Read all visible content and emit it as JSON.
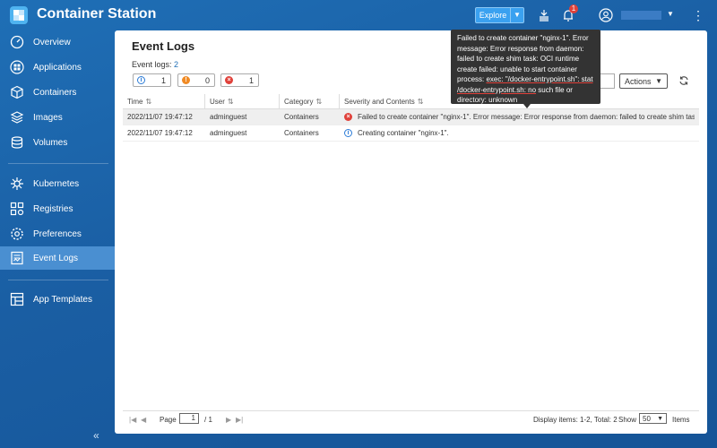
{
  "app": {
    "title": "Container Station"
  },
  "header": {
    "explore_label": "Explore",
    "notification_count": "1",
    "icons": [
      "explore-dropdown-icon",
      "stack-icon",
      "bell-icon",
      "user-avatar-icon",
      "more-vert-icon"
    ]
  },
  "sidebar": {
    "items": [
      {
        "label": "Overview",
        "icon": "gauge-icon"
      },
      {
        "label": "Applications",
        "icon": "grid-icon"
      },
      {
        "label": "Containers",
        "icon": "cube-icon"
      },
      {
        "label": "Images",
        "icon": "layers-icon"
      },
      {
        "label": "Volumes",
        "icon": "database-icon"
      },
      {
        "label": "Kubernetes",
        "icon": "helm-icon"
      },
      {
        "label": "Registries",
        "icon": "registry-icon"
      },
      {
        "label": "Preferences",
        "icon": "gear-icon"
      },
      {
        "label": "Event Logs",
        "icon": "log-icon"
      },
      {
        "label": "App Templates",
        "icon": "template-icon"
      }
    ],
    "active": "Event Logs"
  },
  "main": {
    "title": "Event Logs",
    "count_label": "Event logs:",
    "count_value": "2",
    "filters": {
      "info": "1",
      "warning": "0",
      "error": "1"
    },
    "actions_label": "Actions"
  },
  "table": {
    "headers": {
      "time": "Time",
      "user": "User",
      "category": "Category",
      "severity": "Severity and Contents"
    },
    "rows": [
      {
        "time": "2022/11/07 19:47:12",
        "user": "adminguest",
        "category": "Containers",
        "severity": "error",
        "content": "Failed to create container \"nginx-1\". Error message: Error response from daemon: failed to create shim task: OCI runtime create failed: unable to start container process: exec: \"/docker-entrypoint.sh\": stat /docker-entrypoint.sh: no such file or directory: unknown"
      },
      {
        "time": "2022/11/07 19:47:12",
        "user": "adminguest",
        "category": "Containers",
        "severity": "info",
        "content": "Creating container \"nginx-1\"."
      }
    ]
  },
  "tooltip": {
    "part1": "Failed to create container \"nginx-1\". Error message: Error response from daemon: failed to create shim task: OCI runtime create failed: unable to start container process: ",
    "part2": "exec: \"/docker-entrypoint.sh\": stat /docker-entrypoint.sh: no",
    "part3": " such file or directory: unknown"
  },
  "pager": {
    "page_label": "Page",
    "page_value": "1",
    "page_total": "/ 1",
    "display_items": "Display items: 1-2, Total: 2",
    "show_label": "Show",
    "show_value": "50",
    "items_label": "Items"
  },
  "colors": {
    "error": "#e0413a",
    "warning": "#f08a24",
    "info": "#2b7bd6",
    "accent": "#1f6fb6"
  }
}
